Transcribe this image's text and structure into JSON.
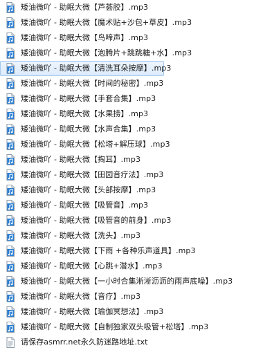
{
  "files": [
    {
      "name": "矮油微吖 - 助眠大微【芦荟胶】.mp3",
      "type": "audio",
      "icon": "audio-file-icon"
    },
    {
      "name": "矮油微吖 - 助眠大微【魔术贴+沙包+草皮】.mp3",
      "type": "audio",
      "icon": "audio-file-icon"
    },
    {
      "name": "矮油微吖 - 助眠大微【鸟啼声】.mp3",
      "type": "audio",
      "icon": "audio-file-icon"
    },
    {
      "name": "矮油微吖 - 助眠大微【泡腾片+跳跳糖+水】.mp3",
      "type": "audio",
      "icon": "audio-file-icon"
    },
    {
      "name": "矮油微吖 - 助眠大微【清洗耳朵按摩】.mp3",
      "type": "audio",
      "icon": "audio-file-icon",
      "selected": true
    },
    {
      "name": "矮油微吖 - 助眠大微【时间的秘密】.mp3",
      "type": "audio",
      "icon": "audio-file-icon"
    },
    {
      "name": "矮油微吖 - 助眠大微【手套合集】.mp3",
      "type": "audio",
      "icon": "audio-file-icon"
    },
    {
      "name": "矮油微吖 - 助眠大微【水果捞】.mp3",
      "type": "audio",
      "icon": "audio-file-icon"
    },
    {
      "name": "矮油微吖 - 助眠大微【水声合集】.mp3",
      "type": "audio",
      "icon": "audio-file-icon"
    },
    {
      "name": "矮油微吖 - 助眠大微【松塔+解压球】.mp3",
      "type": "audio",
      "icon": "audio-file-icon"
    },
    {
      "name": "矮油微吖 - 助眠大微【掏耳】.mp3",
      "type": "audio",
      "icon": "audio-file-icon"
    },
    {
      "name": "矮油微吖 - 助眠大微【田园音疗法】.mp3",
      "type": "audio",
      "icon": "audio-file-icon"
    },
    {
      "name": "矮油微吖 - 助眠大微【头部按摩】.mp3",
      "type": "audio",
      "icon": "audio-file-icon"
    },
    {
      "name": "矮油微吖 - 助眠大微【吸管音】.mp3",
      "type": "audio",
      "icon": "audio-file-icon"
    },
    {
      "name": "矮油微吖 - 助眠大微【吸管音的前身】.mp3",
      "type": "audio",
      "icon": "audio-file-icon"
    },
    {
      "name": "矮油微吖 - 助眠大微【洗头】.mp3",
      "type": "audio",
      "icon": "audio-file-icon"
    },
    {
      "name": "矮油微吖 - 助眠大微【下雨 +各种乐声道具】.mp3",
      "type": "audio",
      "icon": "audio-file-icon"
    },
    {
      "name": "矮油微吖 - 助眠大微【心跳+潜水】.mp3",
      "type": "audio",
      "icon": "audio-file-icon"
    },
    {
      "name": "矮油微吖 - 助眠大微【一小时合集淅淅沥沥的雨声底噪】.mp3",
      "type": "audio",
      "icon": "audio-file-icon"
    },
    {
      "name": "矮油微吖 - 助眠大微【音疗】.mp3",
      "type": "audio",
      "icon": "audio-file-icon"
    },
    {
      "name": "矮油微吖 - 助眠大微【瑜伽冥想法】.mp3",
      "type": "audio",
      "icon": "audio-file-icon"
    },
    {
      "name": "矮油微吖 - 助眠大微【自制独家双头吸管+松塔】.mp3",
      "type": "audio",
      "icon": "audio-file-icon"
    },
    {
      "name": "请保存asmrr.net永久防迷路地址.txt",
      "type": "text",
      "icon": "text-file-icon"
    }
  ],
  "colors": {
    "selection_bg": "#dcebfc",
    "selection_border": "#a3c8ef",
    "audio_icon_blue": "#2a7fd4",
    "text": "#1a1a1a"
  }
}
